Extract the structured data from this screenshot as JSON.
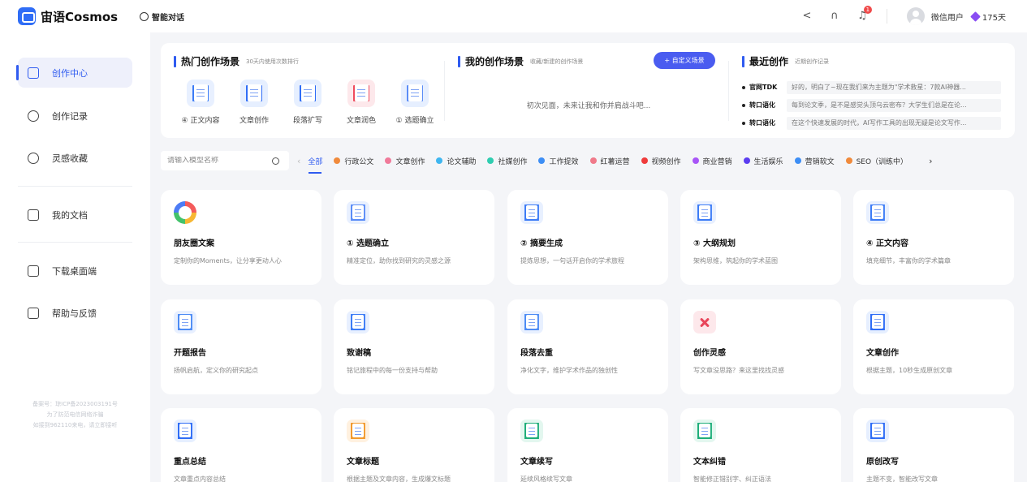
{
  "app": {
    "name": "宙语Cosmos"
  },
  "topbar": {
    "chat_tab": "智能对话",
    "notification_count": "1",
    "user_name": "微信用户",
    "vip_days": "175天"
  },
  "sidebar": {
    "items": [
      {
        "label": "创作中心",
        "icon": "home-icon",
        "active": true
      },
      {
        "label": "创作记录",
        "icon": "cloud-icon"
      },
      {
        "label": "灵感收藏",
        "icon": "lightbulb-icon"
      },
      {
        "label": "我的文档",
        "icon": "book-icon"
      },
      {
        "label": "下载桌面端",
        "icon": "monitor-icon"
      },
      {
        "label": "帮助与反馈",
        "icon": "mail-icon"
      }
    ],
    "footer_lines": [
      "备案号：琼ICP备2023003191号",
      "为了防范电信网络诈骗",
      "如接到962110来电，请立即接听"
    ]
  },
  "hot": {
    "title": "热门创作场景",
    "subtitle": "30天内使用次数排行",
    "items": [
      {
        "label": "④ 正文内容",
        "color": "#3d7cf6",
        "bg": "#e8f0ff",
        "icon": "document-icon"
      },
      {
        "label": "文章创作",
        "color": "#2f6df6",
        "bg": "#e6efff",
        "icon": "notebook-icon"
      },
      {
        "label": "段落扩写",
        "color": "#2f6df6",
        "bg": "#e6efff",
        "icon": "magnifier-icon"
      },
      {
        "label": "文章润色",
        "color": "#ef4b5e",
        "bg": "#fde8eb",
        "icon": "notebook-red-icon"
      },
      {
        "label": "① 选题确立",
        "color": "#5b8df7",
        "bg": "#e6efff",
        "icon": "checklist-icon"
      }
    ]
  },
  "mine": {
    "title": "我的创作场景",
    "subtitle": "收藏/新建的创作场景",
    "button": "+ 自定义场景",
    "empty_tip": "初次见面，未来让我和你并肩战斗吧..."
  },
  "recent": {
    "title": "最近创作",
    "subtitle": "近期创作记录",
    "items": [
      {
        "tag": "官网TDK",
        "text": "好的，明白了~现在我们来为主题为\"学术救星：7款AI神器..."
      },
      {
        "tag": "转口语化",
        "text": "每到论文季，是不是感觉头顶乌云密布？大学生们总是在论..."
      },
      {
        "tag": "转口语化",
        "text": "在这个快速发展的时代，AI写作工具的出现无疑是论文写作..."
      }
    ]
  },
  "filter": {
    "search_placeholder": "请输入模型名称",
    "categories": [
      {
        "label": "全部",
        "color": "",
        "active": true
      },
      {
        "label": "行政公文",
        "color": "#f08a3c"
      },
      {
        "label": "文章创作",
        "color": "#f07a9a"
      },
      {
        "label": "论文辅助",
        "color": "#3fb6f0"
      },
      {
        "label": "社媒创作",
        "color": "#2fcdb0"
      },
      {
        "label": "工作提效",
        "color": "#3d8ef5"
      },
      {
        "label": "红薯运营",
        "color": "#f07a8a"
      },
      {
        "label": "视频创作",
        "color": "#ef3b3b"
      },
      {
        "label": "商业营销",
        "color": "#a855f7"
      },
      {
        "label": "生活娱乐",
        "color": "#5b3df0"
      },
      {
        "label": "营销软文",
        "color": "#3d8ef5"
      },
      {
        "label": "SEO（训练中）",
        "color": "#f08a3c"
      }
    ]
  },
  "cards": [
    {
      "title": "朋友圈文案",
      "desc": "定制你的Moments，让分享更动人心",
      "icon": "color-ring-icon",
      "bg": "",
      "color": ""
    },
    {
      "title": "① 选题确立",
      "desc": "精准定位，助你找到研究的灵感之源",
      "icon": "checklist-icon",
      "bg": "#e8f0ff",
      "color": "#5b8df7"
    },
    {
      "title": "② 摘要生成",
      "desc": "提炼思想，一句话开启你的学术旅程",
      "icon": "summary-icon",
      "bg": "#e8f0ff",
      "color": "#3d7cf6"
    },
    {
      "title": "③ 大纲规划",
      "desc": "架构思维，筑起你的学术蓝图",
      "icon": "outline-icon",
      "bg": "#e8f0ff",
      "color": "#3d7cf6"
    },
    {
      "title": "④ 正文内容",
      "desc": "填充细节，丰富你的学术篇章",
      "icon": "document-icon",
      "bg": "#e8f0ff",
      "color": "#3d7cf6"
    },
    {
      "title": "开题报告",
      "desc": "扬帆启航，定义你的研究起点",
      "icon": "report-icon",
      "bg": "#e8f0ff",
      "color": "#4d8cf5"
    },
    {
      "title": "致谢稿",
      "desc": "铭记旅程中的每一份支持与帮助",
      "icon": "chat-bubble-icon",
      "bg": "#e8f0ff",
      "color": "#3d7cf6"
    },
    {
      "title": "段落去重",
      "desc": "净化文字，维护学术作品的独创性",
      "icon": "dedupe-icon",
      "bg": "#e8f0ff",
      "color": "#4d8cf5"
    },
    {
      "title": "创作灵感",
      "desc": "写文章没思路？来这里找找灵感",
      "icon": "inspiration-icon",
      "bg": "#fde8eb",
      "color": "#e8455a"
    },
    {
      "title": "文章创作",
      "desc": "根据主题，10秒生成原创文章",
      "icon": "notebook-icon",
      "bg": "#e6efff",
      "color": "#2f6df6"
    },
    {
      "title": "重点总结",
      "desc": "文章重点内容总结",
      "icon": "summary-doc-icon",
      "bg": "#e6efff",
      "color": "#2f6df6"
    },
    {
      "title": "文章标题",
      "desc": "根据主题及文章内容，生成爆文标题",
      "icon": "title-icon",
      "bg": "#fff1e0",
      "color": "#f29a2e"
    },
    {
      "title": "文章续写",
      "desc": "延续风格续写文章",
      "icon": "continue-icon",
      "bg": "#e3f7ef",
      "color": "#1fae7a"
    },
    {
      "title": "文本纠错",
      "desc": "智能修正错别字、纠正语法",
      "icon": "correct-icon",
      "bg": "#e3f7ef",
      "color": "#1fae7a"
    },
    {
      "title": "原创改写",
      "desc": "主题不变，智能改写文章",
      "icon": "rewrite-icon",
      "bg": "#e6efff",
      "color": "#2f6df6"
    }
  ]
}
